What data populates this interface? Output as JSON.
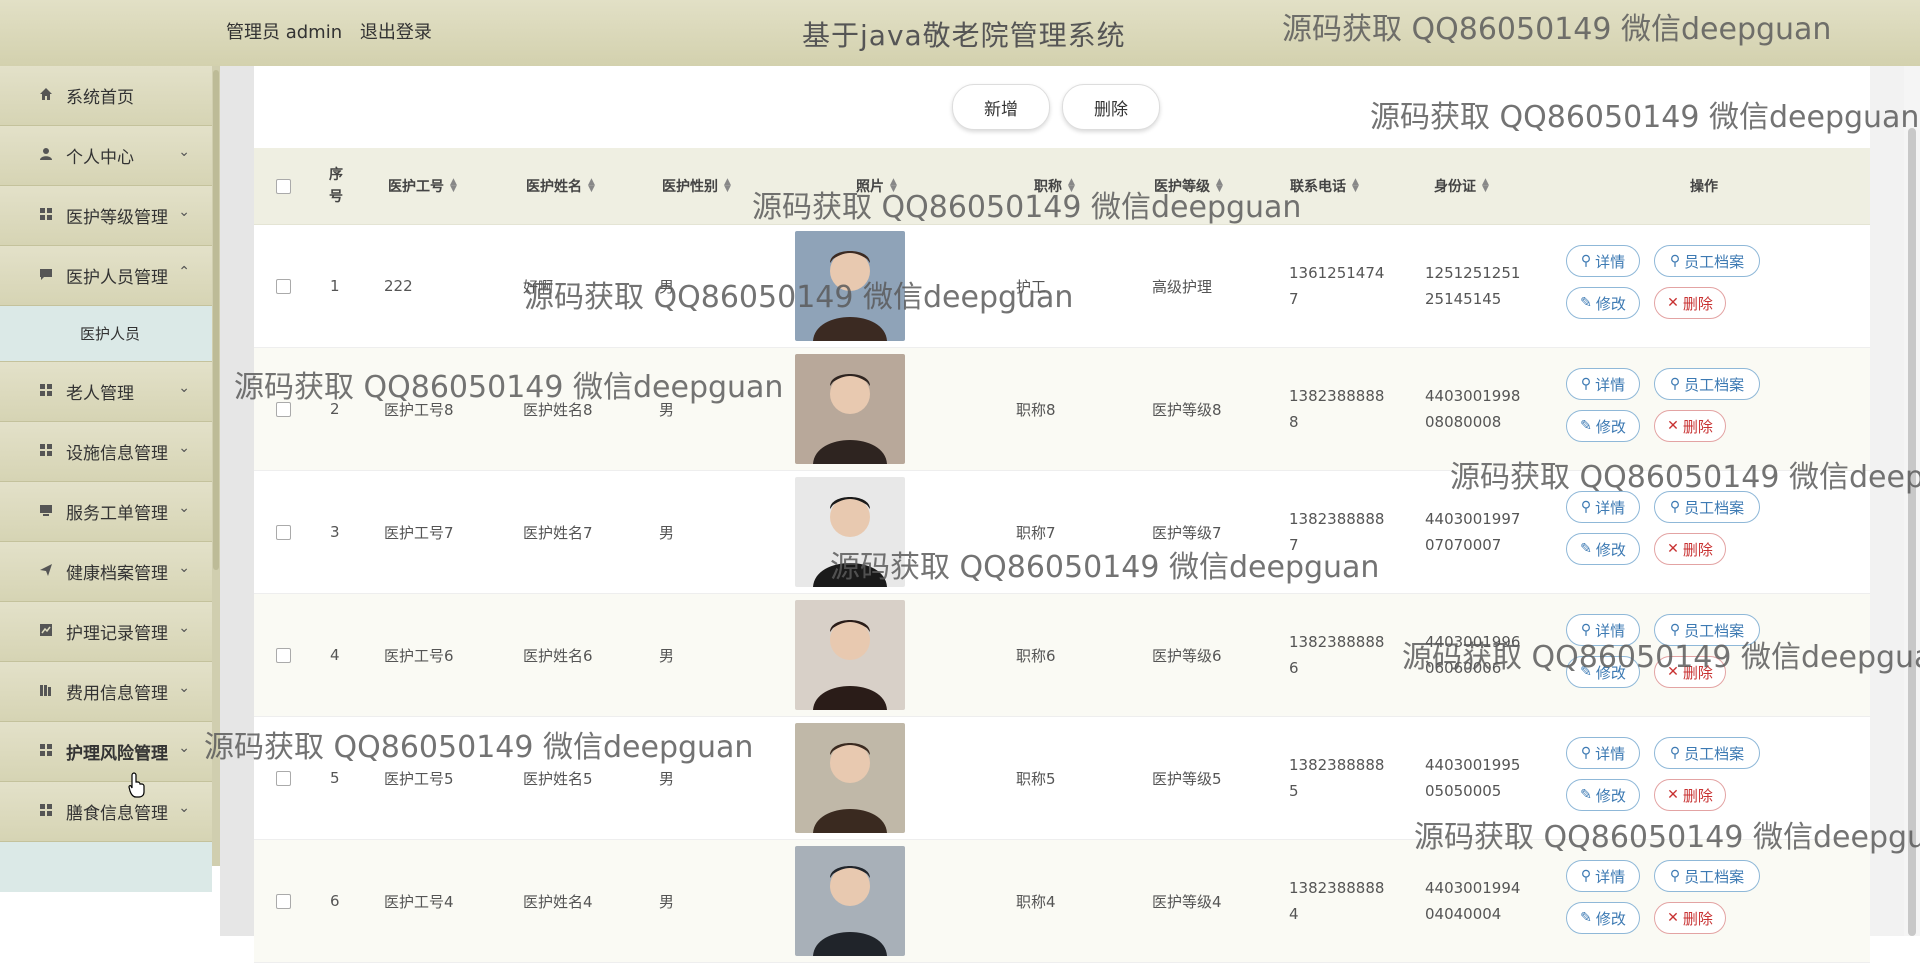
{
  "header": {
    "user_label": "管理员 admin",
    "logout_label": "退出登录",
    "title": "基于java敬老院管理系统"
  },
  "sidebar": {
    "items": [
      {
        "label": "系统首页",
        "icon": "home-icon"
      },
      {
        "label": "个人中心",
        "icon": "user-icon"
      },
      {
        "label": "医护等级管理",
        "icon": "grid-icon"
      },
      {
        "label": "医护人员管理",
        "icon": "chat-icon"
      },
      {
        "label": "老人管理",
        "icon": "grid-icon"
      },
      {
        "label": "设施信息管理",
        "icon": "grid-icon"
      },
      {
        "label": "服务工单管理",
        "icon": "monitor-icon"
      },
      {
        "label": "健康档案管理",
        "icon": "send-icon"
      },
      {
        "label": "护理记录管理",
        "icon": "chart-icon"
      },
      {
        "label": "费用信息管理",
        "icon": "bars-icon"
      },
      {
        "label": "护理风险管理",
        "icon": "grid-icon"
      },
      {
        "label": "膳食信息管理",
        "icon": "grid-icon"
      }
    ],
    "submenu_label": "医护人员"
  },
  "toolbar": {
    "add_label": "新增",
    "delete_label": "删除"
  },
  "table": {
    "headers": {
      "index": "序号",
      "staff_no": "医护工号",
      "staff_name": "医护姓名",
      "gender": "医护性别",
      "photo": "照片",
      "title": "职称",
      "level": "医护等级",
      "phone": "联系电话",
      "id_card": "身份证",
      "actions": "操作"
    },
    "rows": [
      {
        "index": "1",
        "staff_no": "222",
        "staff_name": "好啊",
        "gender": "男",
        "title": "护工",
        "level": "高级护理",
        "phone": "13612514747",
        "id_card": "125125125125145145"
      },
      {
        "index": "2",
        "staff_no": "医护工号8",
        "staff_name": "医护姓名8",
        "gender": "男",
        "title": "职称8",
        "level": "医护等级8",
        "phone": "13823888888",
        "id_card": "440300199808080008"
      },
      {
        "index": "3",
        "staff_no": "医护工号7",
        "staff_name": "医护姓名7",
        "gender": "男",
        "title": "职称7",
        "level": "医护等级7",
        "phone": "13823888887",
        "id_card": "440300199707070007"
      },
      {
        "index": "4",
        "staff_no": "医护工号6",
        "staff_name": "医护姓名6",
        "gender": "男",
        "title": "职称6",
        "level": "医护等级6",
        "phone": "13823888886",
        "id_card": "440300199606060006"
      },
      {
        "index": "5",
        "staff_no": "医护工号5",
        "staff_name": "医护姓名5",
        "gender": "男",
        "title": "职称5",
        "level": "医护等级5",
        "phone": "13823888885",
        "id_card": "440300199505050005"
      },
      {
        "index": "6",
        "staff_no": "医护工号4",
        "staff_name": "医护姓名4",
        "gender": "男",
        "title": "职称4",
        "level": "医护等级4",
        "phone": "13823888884",
        "id_card": "440300199404040004"
      }
    ],
    "actions": {
      "detail": "详情",
      "archive": "员工档案",
      "edit": "修改",
      "delete": "删除"
    }
  },
  "watermark": "源码获取 QQ86050149 微信deepguan",
  "colors": {
    "header_bg": "#d9d7b6",
    "sidebar_bg": "#d9d7b9",
    "submenu_bg": "#dbe9e7",
    "action_blue": "#3d7ab3",
    "action_red": "#c83232"
  }
}
